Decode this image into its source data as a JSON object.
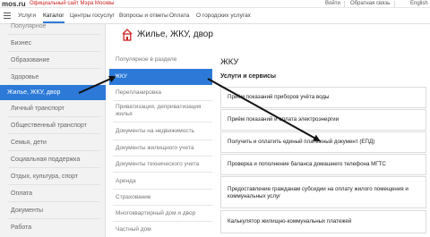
{
  "topbar": {
    "logo": "mos.ru",
    "subtitle": "Официальный сайт Мэра Москвы",
    "login": "Войти",
    "feedback": "Обратная связь",
    "lang": "English"
  },
  "nav": {
    "items": [
      "Услуги",
      "Каталог",
      "Центры госуслуг",
      "Вопросы и ответы",
      "Оплата",
      "О городских услугах"
    ],
    "active_index": 1
  },
  "sidebar": {
    "items": [
      {
        "label": "Популярное"
      },
      {
        "label": "Бизнес"
      },
      {
        "label": "Образование"
      },
      {
        "label": "Здоровье"
      },
      {
        "label": "Жилье, ЖКУ, двор"
      },
      {
        "label": "Личный транспорт"
      },
      {
        "label": "Общественный транспорт"
      },
      {
        "label": "Семья, дети"
      },
      {
        "label": "Социальная поддержка"
      },
      {
        "label": "Отдых, культура, спорт"
      },
      {
        "label": "Оплата"
      },
      {
        "label": "Документы"
      },
      {
        "label": "Работа"
      }
    ],
    "active_index": 4
  },
  "category": {
    "title": "Жилье, ЖКУ, двор",
    "icon": "house-icon"
  },
  "subnav": {
    "items": [
      {
        "label": "Популярное в разделе"
      },
      {
        "label": "ЖКУ"
      },
      {
        "label": "Перепланировка"
      },
      {
        "label": "Приватизация, деприватизация жилья"
      },
      {
        "label": "Документы на недвижимость"
      },
      {
        "label": "Документы жилищного учета"
      },
      {
        "label": "Документы технического учета"
      },
      {
        "label": "Аренда"
      },
      {
        "label": "Страхование"
      },
      {
        "label": "Многоквартирный дом и двор"
      },
      {
        "label": "Частный дом"
      }
    ],
    "active_index": 1
  },
  "content": {
    "title": "ЖКУ",
    "subtitle": "Услуги и сервисы",
    "services": [
      "Приём показаний приборов учёта воды",
      "Приём показаний и оплата электроэнергии",
      "Получить и оплатить единый платежный документ (ЕПД)",
      "Проверка и пополнение баланса домашнего телефона МГТС",
      "Предоставление гражданам субсидии на оплату жилого помещения и коммунальных услуг",
      "Калькулятор жилищно-коммунальных платежей"
    ]
  },
  "colors": {
    "accent": "#2c79d8",
    "brand_red": "#cc2222",
    "sidebar_bg": "#f2f2f2"
  }
}
